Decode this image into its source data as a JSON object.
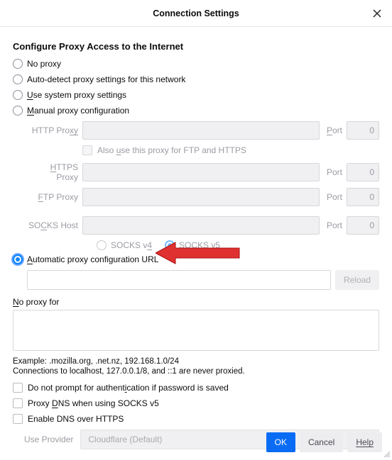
{
  "titlebar": {
    "title": "Connection Settings"
  },
  "heading": "Configure Proxy Access to the Internet",
  "radios": {
    "no_proxy": "No proxy",
    "auto_detect": "Auto-detect proxy settings for this network",
    "use_system_pre": "U",
    "use_system_post": "se system proxy settings",
    "manual_pre": "M",
    "manual_post": "anual proxy configuration",
    "auto_url_pre": "A",
    "auto_url_post": "utomatic proxy configuration URL"
  },
  "manual": {
    "http_label_pre": "HTTP Pro",
    "http_label_post": "xy",
    "https_label_pre": "H",
    "https_label_post": "TTPS Proxy",
    "ftp_label_pre": "F",
    "ftp_label_post": "TP Proxy",
    "socks_label_pre": "SO",
    "socks_label_u": "C",
    "socks_label_post": "KS Host",
    "port_label_pre": "P",
    "port_label_post": "ort",
    "port_value": "0",
    "also_use_pre": "Also ",
    "also_use_u": "u",
    "also_use_post": "se this proxy for FTP and HTTPS",
    "socks_v4_pre": "SOCKS v",
    "socks_v4_u": "4",
    "socks_v5_pre": "SOCKS ",
    "socks_v5_u": "v",
    "socks_v5_post": "5"
  },
  "reload_btn": "Reload",
  "no_proxy_label_pre": "N",
  "no_proxy_label_post": "o proxy for",
  "example": "Example: .mozilla.org, .net.nz, 192.168.1.0/24",
  "localhost_note": "Connections to localhost, 127.0.0.1/8, and ::1 are never proxied.",
  "checkboxes": {
    "no_prompt_pre": "Do not prompt for authentication if password is ",
    "no_prompt_u": "i",
    "no_prompt_post": "saved",
    "proxy_dns_pre": "Proxy ",
    "proxy_dns_u": "D",
    "proxy_dns_post": "NS when using SOCKS v5",
    "enable_doh": "Enable DNS over HTTPS"
  },
  "provider": {
    "label": "Use Provider",
    "value": "Cloudflare (Default)"
  },
  "buttons": {
    "ok": "OK",
    "cancel": "Cancel",
    "help": "Help"
  }
}
